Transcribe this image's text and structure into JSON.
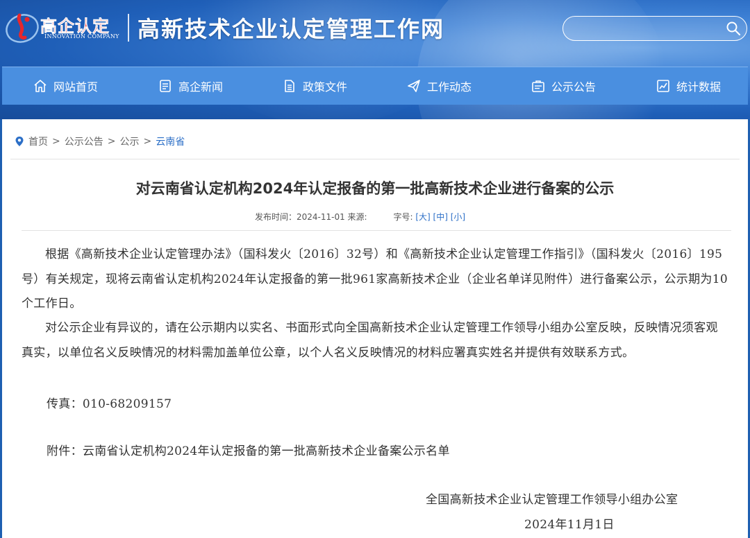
{
  "header": {
    "logo_cn": "高企认定",
    "logo_en": "INNOVATION COMPANY",
    "site_title": "高新技术企业认定管理工作网",
    "search_placeholder": ""
  },
  "nav": [
    {
      "label": "网站首页",
      "icon": "home-icon"
    },
    {
      "label": "高企新闻",
      "icon": "news-icon"
    },
    {
      "label": "政策文件",
      "icon": "document-icon"
    },
    {
      "label": "工作动态",
      "icon": "send-icon"
    },
    {
      "label": "公示公告",
      "icon": "notice-icon"
    },
    {
      "label": "统计数据",
      "icon": "chart-icon"
    }
  ],
  "breadcrumb": {
    "items": [
      "首页",
      "公示公告",
      "公示",
      "云南省"
    ],
    "separator": ">"
  },
  "article": {
    "title": "对云南省认定机构2024年认定报备的第一批高新技术企业进行备案的公示",
    "meta_time_label": "发布时间：2024-11-01 来源:",
    "font_size_label": "字号:",
    "font_large": "[大]",
    "font_medium": "[中]",
    "font_small": "[小]",
    "paragraphs": [
      "根据《高新技术企业认定管理办法》（国科发火〔2016〕32号）和《高新技术企业认定管理工作指引》（国科发火〔2016〕195号）有关规定，现将云南省认定机构2024年认定报备的第一批961家高新技术企业（企业名单详见附件）进行备案公示，公示期为10个工作日。",
      "对公示企业有异议的，请在公示期内以实名、书面形式向全国高新技术企业认定管理工作领导小组办公室反映，反映情况须客观真实，以单位名义反映情况的材料需加盖单位公章，以个人名义反映情况的材料应署真实姓名并提供有效联系方式。"
    ],
    "fax": "传真：010-68209157",
    "attachment": "附件：云南省认定机构2024年认定报备的第一批高新技术企业备案公示名单",
    "signature_org": "全国高新技术企业认定管理工作领导小组办公室",
    "signature_date": "2024年11月1日"
  },
  "colors": {
    "header_blue": "#1f5fb8",
    "nav_blue": "#4a8fe0",
    "link_blue": "#2c6fc7",
    "logo_red": "#e8272c"
  }
}
